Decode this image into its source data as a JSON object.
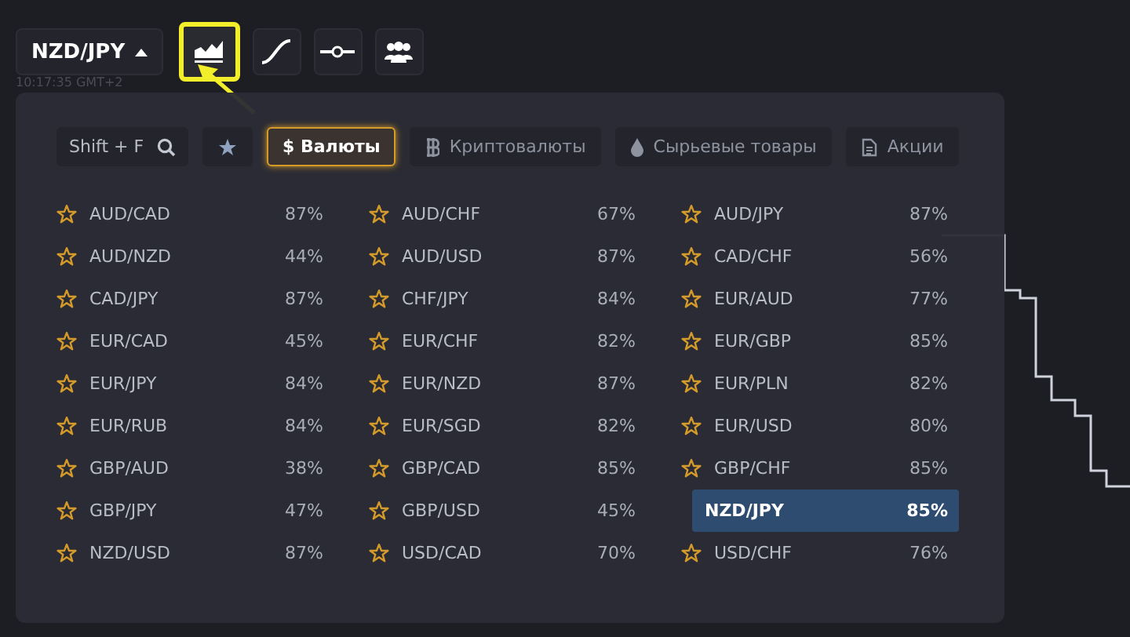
{
  "toolbar": {
    "pair": "NZD/JPY",
    "tools": [
      {
        "kind": "area",
        "selected": true
      },
      {
        "kind": "curve",
        "selected": false
      },
      {
        "kind": "slider",
        "selected": false
      },
      {
        "kind": "people",
        "selected": false
      }
    ]
  },
  "chart": {
    "time": "10:17:35 GMT+2"
  },
  "picker": {
    "search": {
      "placeholder": "Shift + F"
    },
    "tabs": [
      {
        "kind": "favorites",
        "selected": false
      },
      {
        "kind": "currency",
        "label": "$ Валюты",
        "selected": true
      },
      {
        "kind": "crypto",
        "label": "Криптовалюты",
        "selected": false
      },
      {
        "kind": "commodity",
        "label": "Сырьевые товары",
        "selected": false
      },
      {
        "kind": "stocks",
        "label": "Акции",
        "selected": false
      }
    ],
    "pairs": [
      {
        "name": "AUD/CAD",
        "payout": "87%",
        "selected": false
      },
      {
        "name": "AUD/CHF",
        "payout": "67%",
        "selected": false
      },
      {
        "name": "AUD/JPY",
        "payout": "87%",
        "selected": false
      },
      {
        "name": "AUD/NZD",
        "payout": "44%",
        "selected": false
      },
      {
        "name": "AUD/USD",
        "payout": "87%",
        "selected": false
      },
      {
        "name": "CAD/CHF",
        "payout": "56%",
        "selected": false
      },
      {
        "name": "CAD/JPY",
        "payout": "87%",
        "selected": false
      },
      {
        "name": "CHF/JPY",
        "payout": "84%",
        "selected": false
      },
      {
        "name": "EUR/AUD",
        "payout": "77%",
        "selected": false
      },
      {
        "name": "EUR/CAD",
        "payout": "45%",
        "selected": false
      },
      {
        "name": "EUR/CHF",
        "payout": "82%",
        "selected": false
      },
      {
        "name": "EUR/GBP",
        "payout": "85%",
        "selected": false
      },
      {
        "name": "EUR/JPY",
        "payout": "84%",
        "selected": false
      },
      {
        "name": "EUR/NZD",
        "payout": "87%",
        "selected": false
      },
      {
        "name": "EUR/PLN",
        "payout": "82%",
        "selected": false
      },
      {
        "name": "EUR/RUB",
        "payout": "84%",
        "selected": false
      },
      {
        "name": "EUR/SGD",
        "payout": "82%",
        "selected": false
      },
      {
        "name": "EUR/USD",
        "payout": "80%",
        "selected": false
      },
      {
        "name": "GBP/AUD",
        "payout": "38%",
        "selected": false
      },
      {
        "name": "GBP/CAD",
        "payout": "85%",
        "selected": false
      },
      {
        "name": "GBP/CHF",
        "payout": "85%",
        "selected": false
      },
      {
        "name": "GBP/JPY",
        "payout": "47%",
        "selected": false
      },
      {
        "name": "GBP/USD",
        "payout": "45%",
        "selected": false
      },
      {
        "name": "NZD/JPY",
        "payout": "85%",
        "selected": true
      },
      {
        "name": "NZD/USD",
        "payout": "87%",
        "selected": false
      },
      {
        "name": "USD/CAD",
        "payout": "70%",
        "selected": false
      },
      {
        "name": "USD/CHF",
        "payout": "76%",
        "selected": false
      }
    ]
  }
}
